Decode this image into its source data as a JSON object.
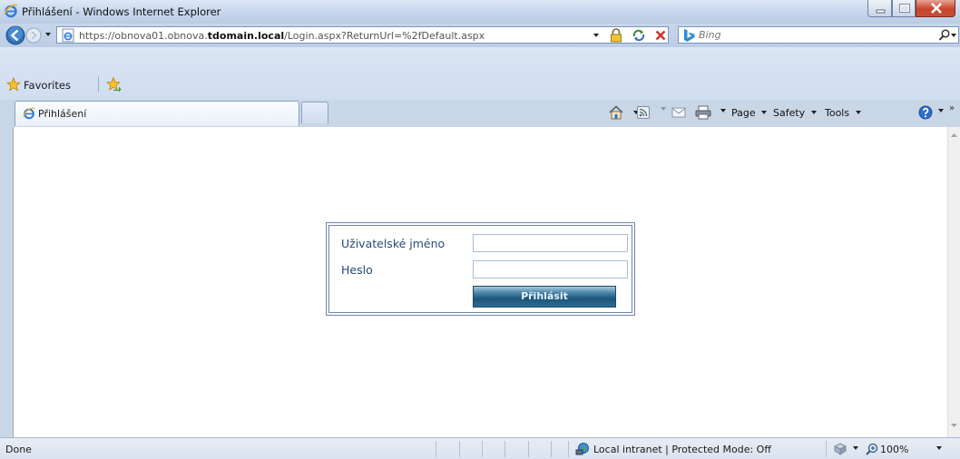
{
  "window": {
    "title": "Přihlášení - Windows Internet Explorer"
  },
  "address_bar": {
    "url_prefix": "https://obnova01.obnova.",
    "url_domain": "tdomain.local",
    "url_suffix": "/Login.aspx?ReturnUrl=%2fDefault.aspx"
  },
  "search": {
    "placeholder": "Bing"
  },
  "favorites": {
    "label": "Favorites"
  },
  "tabs": [
    {
      "label": "Přihlášení",
      "active": true
    }
  ],
  "command_bar": {
    "page_label": "Page",
    "safety_label": "Safety",
    "tools_label": "Tools"
  },
  "login_form": {
    "username_label": "Uživatelské jméno",
    "username_value": "",
    "password_label": "Heslo",
    "password_value": "",
    "submit_label": "Přihlásit"
  },
  "status_bar": {
    "status": "Done",
    "zone": "Local intranet | Protected Mode: Off",
    "zoom": "100%"
  },
  "colors": {
    "label_text": "#264b73",
    "button_dark": "#1c5679",
    "frame_blue": "#6e87a8"
  }
}
